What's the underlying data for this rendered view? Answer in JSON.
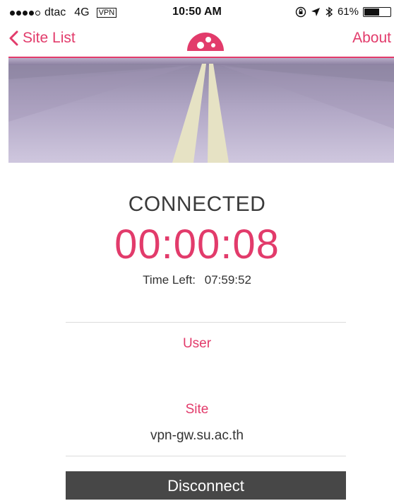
{
  "status_bar": {
    "carrier": "dtac",
    "network": "4G",
    "vpn": "VPN",
    "time": "10:50 AM",
    "battery": "61%",
    "battery_level": 0.61,
    "icons": [
      "lock-rotation-icon",
      "location-arrow-icon",
      "bluetooth-icon",
      "battery-icon"
    ]
  },
  "nav": {
    "back_label": "Site List",
    "about_label": "About",
    "accent_color": "#e23b6b"
  },
  "connection": {
    "status": "CONNECTED",
    "elapsed": "00:00:08",
    "time_left_label": "Time Left:",
    "time_left_value": "07:59:52"
  },
  "details": {
    "user_label": "User",
    "user_value": "",
    "site_label": "Site",
    "site_value": "vpn-gw.su.ac.th"
  },
  "actions": {
    "disconnect_label": "Disconnect"
  }
}
